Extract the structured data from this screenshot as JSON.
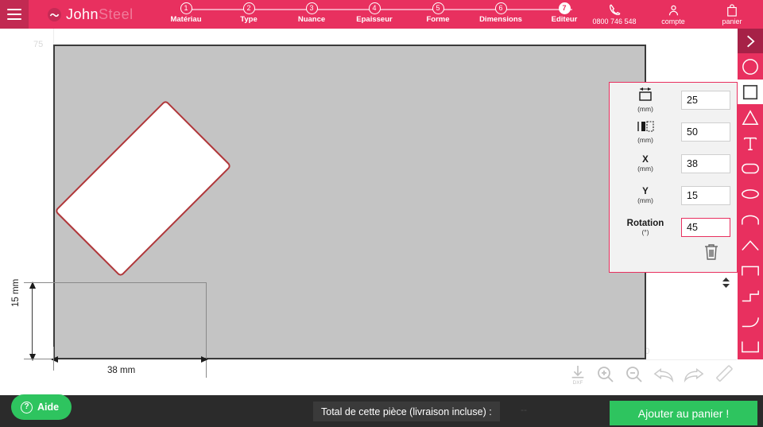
{
  "header": {
    "menu_icon": "hamburger-icon",
    "brand_primary": "John",
    "brand_secondary": "Steel",
    "logo_icon": "johnsteel-logo-icon",
    "steps": [
      {
        "num": "1",
        "label": "Matériau",
        "active": false
      },
      {
        "num": "2",
        "label": "Type",
        "active": false
      },
      {
        "num": "3",
        "label": "Nuance",
        "active": false
      },
      {
        "num": "4",
        "label": "Epaisseur",
        "active": false
      },
      {
        "num": "5",
        "label": "Forme",
        "active": false
      },
      {
        "num": "6",
        "label": "Dimensions",
        "active": false
      },
      {
        "num": "7",
        "label": "Editeur",
        "active": true
      }
    ],
    "phone": {
      "icon": "phone-icon",
      "label": "0800 746 548"
    },
    "account": {
      "icon": "user-icon",
      "label": "compte"
    },
    "cart": {
      "icon": "shopping-bag-icon",
      "label": "panier"
    }
  },
  "canvas": {
    "axis_y_label": "75",
    "axis_x_label": "150",
    "dimension_height": "15 mm",
    "dimension_width": "38 mm",
    "plate_color": "#c4c4c4",
    "shape_stroke_color": "#b0373a",
    "shape_fill_color": "#ffffff"
  },
  "properties": {
    "rows": [
      {
        "icon": "width-dimension-icon",
        "label": "",
        "unit": "(mm)",
        "value": "25",
        "accent": false
      },
      {
        "icon": "height-dimension-icon",
        "label": "",
        "unit": "(mm)",
        "value": "50",
        "accent": false
      },
      {
        "icon": "",
        "label": "X",
        "unit": "(mm)",
        "value": "38",
        "accent": false
      },
      {
        "icon": "",
        "label": "Y",
        "unit": "(mm)",
        "value": "15",
        "accent": false
      },
      {
        "icon": "",
        "label": "Rotation",
        "unit": "(°)",
        "value": "45",
        "accent": true
      }
    ],
    "delete_icon": "trash-icon",
    "spinner_icon": "spinner-up-down-icon",
    "accent_color": "#e8305f"
  },
  "toolbar": {
    "items": [
      {
        "name": "chevron-right-tool",
        "selected": true
      },
      {
        "name": "circle-tool",
        "selected": false
      },
      {
        "name": "square-tool",
        "selected": false,
        "white": true
      },
      {
        "name": "triangle-tool",
        "selected": false
      },
      {
        "name": "text-tool",
        "selected": false
      },
      {
        "name": "stadium-tool",
        "selected": false
      },
      {
        "name": "ellipse-tool",
        "selected": false
      },
      {
        "name": "arch-tool",
        "selected": false
      },
      {
        "name": "chevron-up-tool",
        "selected": false
      },
      {
        "name": "square-notch-tool",
        "selected": false
      },
      {
        "name": "step-tool",
        "selected": false
      },
      {
        "name": "curve-corner-tool",
        "selected": false
      },
      {
        "name": "corner-tool",
        "selected": false
      }
    ]
  },
  "bottom_icons": [
    {
      "name": "download-dxf-icon",
      "label": "DXF"
    },
    {
      "name": "zoom-in-icon",
      "label": ""
    },
    {
      "name": "zoom-out-icon",
      "label": ""
    },
    {
      "name": "undo-icon",
      "label": ""
    },
    {
      "name": "redo-icon",
      "label": ""
    },
    {
      "name": "ruler-icon",
      "label": ""
    }
  ],
  "footer": {
    "help_label": "Aide",
    "help_icon": "question-mark-icon",
    "total_label": "Total de cette pièce (livraison incluse) :",
    "total_value": "--",
    "cart_button_label": "Ajouter au panier !",
    "cart_button_color": "#2ec45f"
  }
}
